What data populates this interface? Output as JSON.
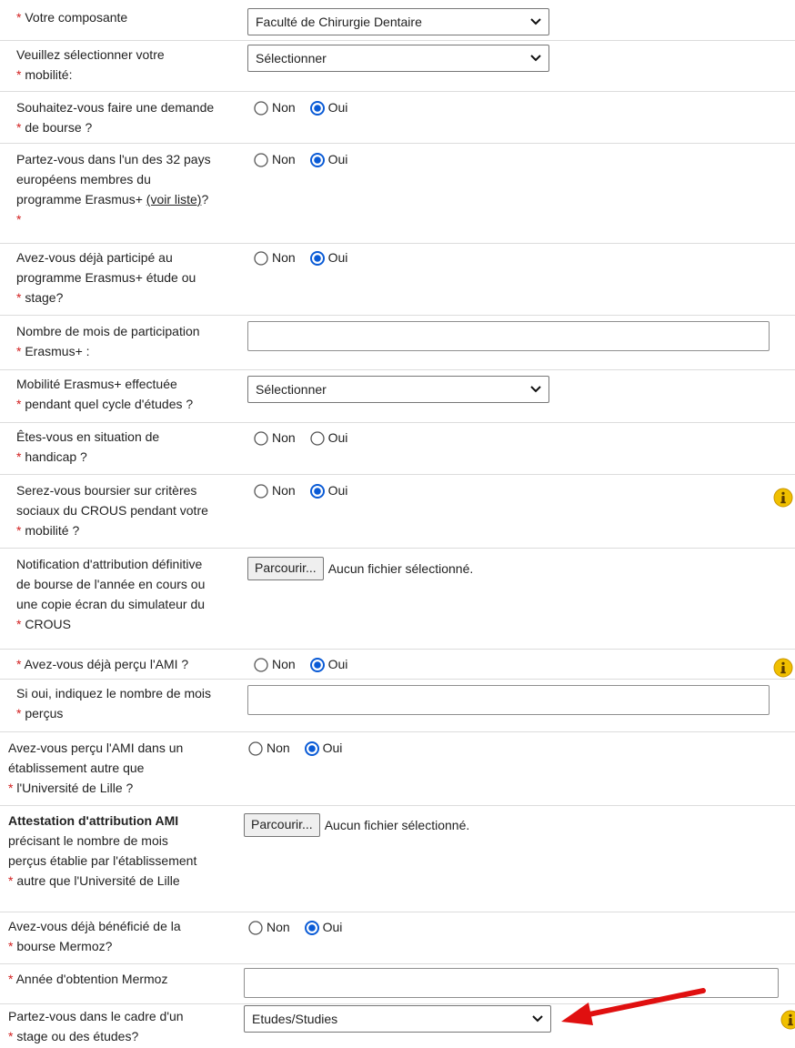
{
  "required_marker": "*",
  "colors": {
    "required": "#d21e1e",
    "info_icon": "#e8b200",
    "arrow": "#e01010",
    "radio_checked": "#0a5bd6"
  },
  "radio_labels": {
    "no": "Non",
    "yes": "Oui"
  },
  "file_input": {
    "button_label": "Parcourir...",
    "no_file_text": "Aucun fichier sélectionné."
  },
  "fields": {
    "composante": {
      "label": "Votre composante",
      "value": "Faculté de Chirurgie Dentaire"
    },
    "mobilite": {
      "label_1": "Veuillez sélectionner votre",
      "label_2": "mobilité:",
      "value": "Sélectionner"
    },
    "bourse": {
      "label_1": "Souhaitez-vous faire une demande",
      "label_2": "de bourse ?",
      "selected": "Oui"
    },
    "pays": {
      "label_1": "Partez-vous dans l'un des 32 pays",
      "label_2": "européens membres du",
      "label_3": "programme Erasmus+ ",
      "link": "(voir liste)",
      "label_4": "?",
      "selected": "Oui"
    },
    "erasmus_deja": {
      "label_1": "Avez-vous déjà participé au",
      "label_2": "programme Erasmus+ étude ou",
      "label_3": "stage?",
      "selected": "Oui"
    },
    "mois_erasmus": {
      "label_1": "Nombre de mois de participation",
      "label_2": "Erasmus+ :",
      "value": ""
    },
    "cycle": {
      "label_1": "Mobilité Erasmus+ effectuée",
      "label_2": "pendant quel cycle d'études ?",
      "value": "Sélectionner"
    },
    "handicap": {
      "label_1": "Êtes-vous en situation de",
      "label_2": "handicap ?",
      "selected": ""
    },
    "crous": {
      "label_1": "Serez-vous boursier sur critères",
      "label_2": "sociaux du CROUS pendant votre",
      "label_3": "mobilité ?",
      "selected": "Oui"
    },
    "notification": {
      "label_1": "Notification d'attribution définitive",
      "label_2": "de bourse de l'année en cours ou",
      "label_3": "une copie écran du simulateur du",
      "label_4": "CROUS"
    },
    "ami": {
      "label": "Avez-vous déjà perçu l'AMI ?",
      "selected": "Oui"
    },
    "ami_mois": {
      "label_1": "Si oui, indiquez le nombre de mois",
      "label_2": "perçus",
      "value": ""
    },
    "ami_autre": {
      "label_1": "Avez-vous perçu l'AMI dans un",
      "label_2": "établissement autre que",
      "label_3": "l'Université de Lille ?",
      "selected": "Oui"
    },
    "attestation": {
      "label_1": "Attestation d'attribution AMI",
      "label_2": "précisant le nombre de mois",
      "label_3": "perçus établie par l'établissement",
      "label_4": "autre que l'Université de Lille"
    },
    "mermoz": {
      "label_1": "Avez-vous déjà bénéficié de la",
      "label_2": "bourse Mermoz?",
      "selected": "Oui"
    },
    "mermoz_annee": {
      "label": "Année d'obtention Mermoz",
      "value": ""
    },
    "cadre": {
      "label_1": "Partez-vous dans le cadre d'un",
      "label_2": "stage ou des études?",
      "value": "Etudes/Studies"
    }
  }
}
